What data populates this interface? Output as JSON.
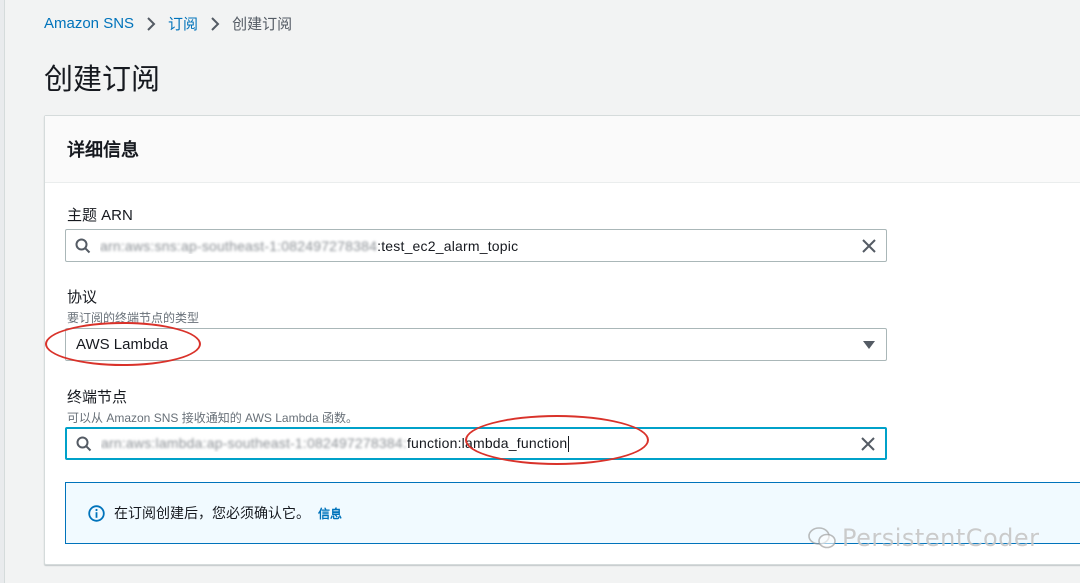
{
  "breadcrumb": {
    "items": [
      "Amazon SNS",
      "订阅"
    ],
    "current": "创建订阅"
  },
  "page_title": "创建订阅",
  "panel": {
    "title": "详细信息",
    "topic_arn": {
      "label": "主题 ARN",
      "value_blurred": "arn:aws:sns:ap-southeast-1:082497278384",
      "value_visible": ":test_ec2_alarm_topic"
    },
    "protocol": {
      "label": "协议",
      "description": "要订阅的终端节点的类型",
      "selected": "AWS Lambda"
    },
    "endpoint": {
      "label": "终端节点",
      "description": "可以从 Amazon SNS 接收通知的 AWS Lambda 函数。",
      "value_blurred": "arn:aws:lambda:ap-southeast-1:082497278384:",
      "value_visible": "function:lambda_function"
    },
    "alert": {
      "text": "在订阅创建后，您必须确认它。",
      "link": "信息"
    }
  },
  "watermark": "PersistentCoder",
  "colors": {
    "link": "#0073bb",
    "focus": "#00a1c9",
    "annotation": "#d9322a",
    "alert_bg": "#f1faff"
  }
}
